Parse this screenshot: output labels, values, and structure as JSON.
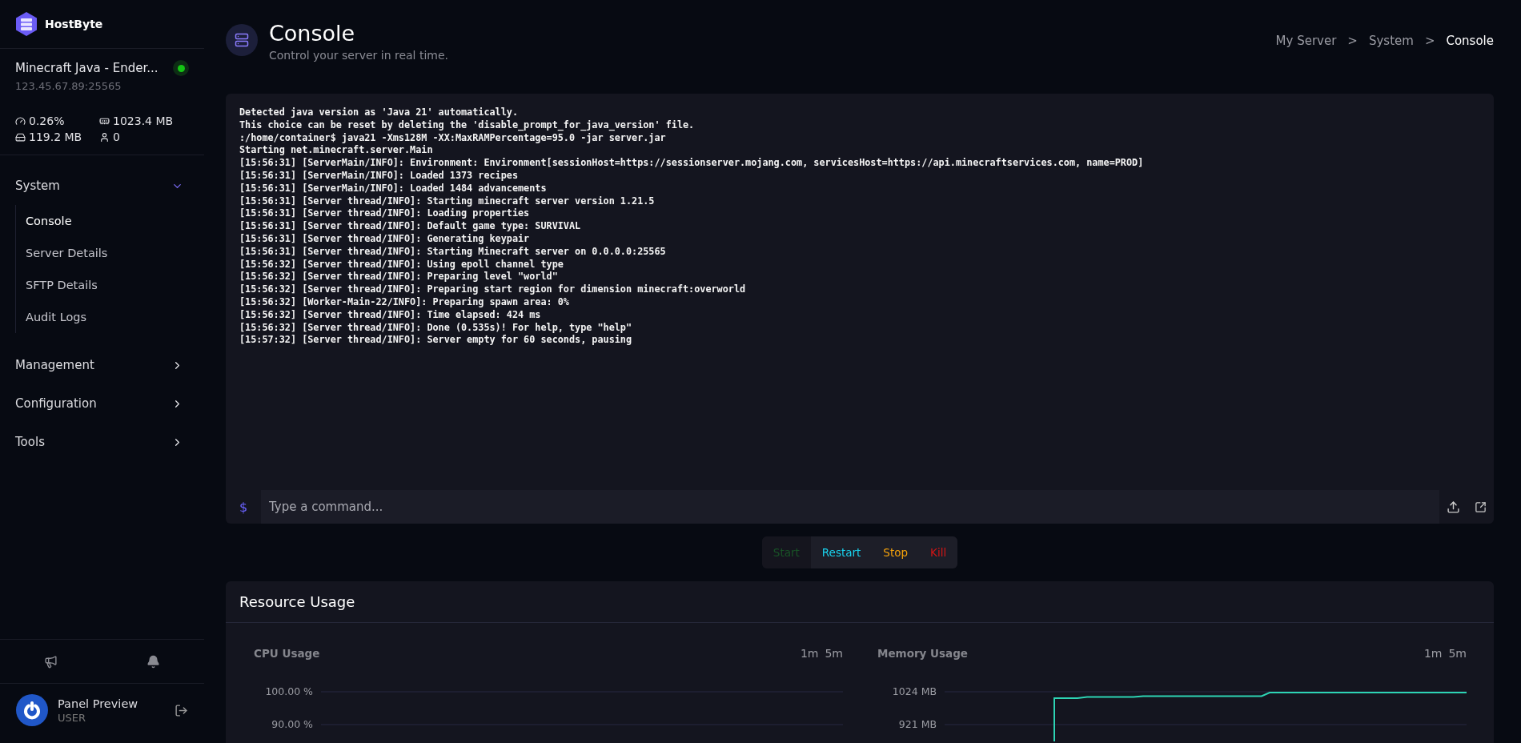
{
  "brand": {
    "name": "HostByte"
  },
  "server": {
    "name": "Minecraft Java - Ender...",
    "address": "123.45.67.89:25565",
    "online": true,
    "stats": [
      {
        "kind": "cpu",
        "value": "0.26%"
      },
      {
        "kind": "memory",
        "value": "1023.4 MB"
      },
      {
        "kind": "disk",
        "value": "119.2 MB"
      },
      {
        "kind": "players",
        "value": "0"
      }
    ]
  },
  "nav": [
    {
      "label": "System",
      "expanded": true,
      "children": [
        {
          "label": "Console",
          "selected": true
        },
        {
          "label": "Server Details",
          "selected": false
        },
        {
          "label": "SFTP Details",
          "selected": false
        },
        {
          "label": "Audit Logs",
          "selected": false
        }
      ]
    },
    {
      "label": "Management",
      "expanded": false
    },
    {
      "label": "Configuration",
      "expanded": false
    },
    {
      "label": "Tools",
      "expanded": false
    }
  ],
  "user": {
    "name": "Panel Preview",
    "role": "USER"
  },
  "header": {
    "title": "Console",
    "subtitle": "Control your server in real time.",
    "breadcrumb": [
      "My Server",
      "System",
      "Console"
    ],
    "separator": ">"
  },
  "console": {
    "lines": [
      "Detected java version as 'Java 21' automatically.",
      "This choice can be reset by deleting the 'disable_prompt_for_java_version' file.",
      ":/home/container$ java21 -Xms128M -XX:MaxRAMPercentage=95.0 -jar server.jar",
      "Starting net.minecraft.server.Main",
      "[15:56:31] [ServerMain/INFO]: Environment: Environment[sessionHost=https://sessionserver.mojang.com, servicesHost=https://api.minecraftservices.com, name=PROD]",
      "[15:56:31] [ServerMain/INFO]: Loaded 1373 recipes",
      "[15:56:31] [ServerMain/INFO]: Loaded 1484 advancements",
      "[15:56:31] [Server thread/INFO]: Starting minecraft server version 1.21.5",
      "[15:56:31] [Server thread/INFO]: Loading properties",
      "[15:56:31] [Server thread/INFO]: Default game type: SURVIVAL",
      "[15:56:31] [Server thread/INFO]: Generating keypair",
      "[15:56:31] [Server thread/INFO]: Starting Minecraft server on 0.0.0.0:25565",
      "[15:56:32] [Server thread/INFO]: Using epoll channel type",
      "[15:56:32] [Server thread/INFO]: Preparing level \"world\"",
      "[15:56:32] [Server thread/INFO]: Preparing start region for dimension minecraft:overworld",
      "[15:56:32] [Worker-Main-22/INFO]: Preparing spawn area: 0%",
      "[15:56:32] [Server thread/INFO]: Time elapsed: 424 ms",
      "[15:56:32] [Server thread/INFO]: Done (0.535s)! For help, type \"help\"",
      "[15:57:32] [Server thread/INFO]: Server empty for 60 seconds, pausing"
    ],
    "prompt": "$",
    "placeholder": "Type a command..."
  },
  "power_buttons": [
    {
      "kind": "start",
      "label": "Start",
      "disabled": true
    },
    {
      "kind": "restart",
      "label": "Restart",
      "disabled": false
    },
    {
      "kind": "stop",
      "label": "Stop",
      "disabled": false
    },
    {
      "kind": "kill",
      "label": "Kill",
      "disabled": false
    }
  ],
  "resources": {
    "title": "Resource Usage",
    "charts": [
      {
        "kind": "empty",
        "title": "CPU Usage",
        "ranges": [
          "1m",
          "5m"
        ],
        "tick_labels": [
          "100.00 %",
          "90.00 %"
        ]
      },
      {
        "kind": "line",
        "title": "Memory Usage",
        "ranges": [
          "1m",
          "5m"
        ],
        "tick_labels": [
          "1024 MB",
          "921 MB"
        ]
      }
    ]
  }
}
